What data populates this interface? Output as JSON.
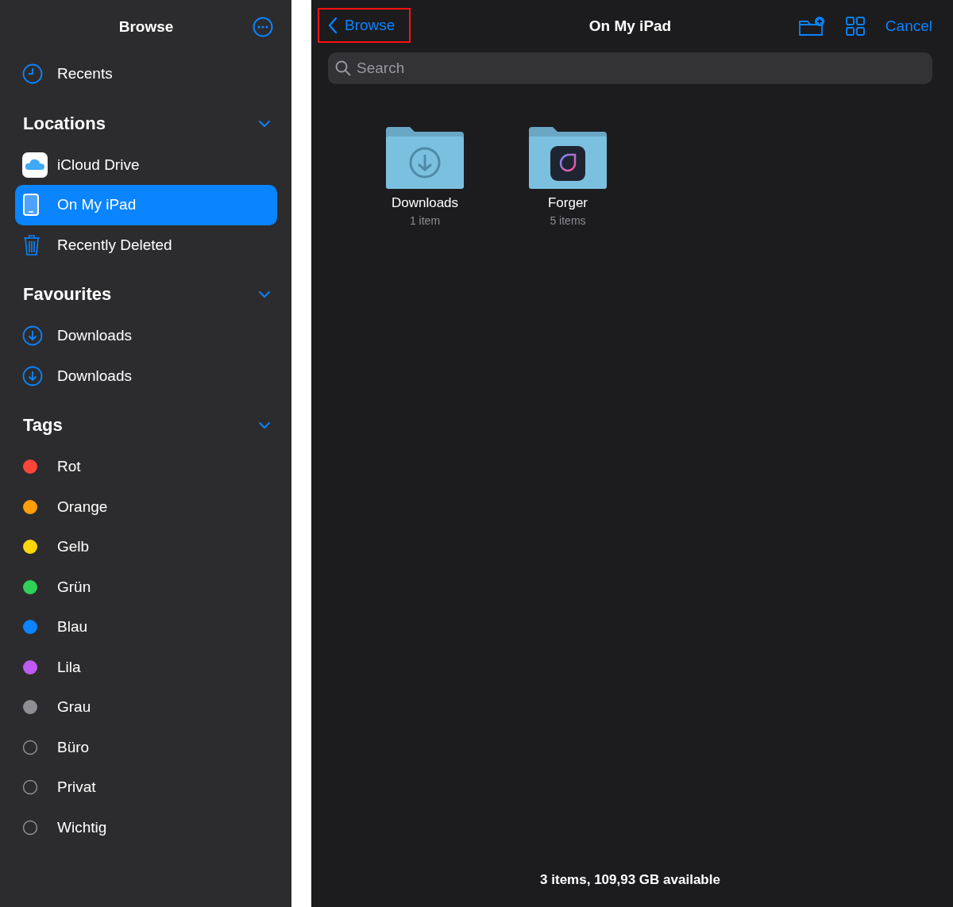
{
  "sidebar": {
    "title": "Browse",
    "recents": {
      "label": "Recents"
    },
    "sections": [
      {
        "title": "Locations",
        "expanded": true,
        "items": [
          {
            "label": "iCloud Drive",
            "kind": "cloud",
            "selected": false
          },
          {
            "label": "On My iPad",
            "kind": "tablet",
            "selected": true
          },
          {
            "label": "Recently Deleted",
            "kind": "trash",
            "selected": false
          }
        ]
      },
      {
        "title": "Favourites",
        "expanded": true,
        "items": [
          {
            "label": "Downloads",
            "kind": "download",
            "selected": false
          },
          {
            "label": "Downloads",
            "kind": "download",
            "selected": false
          }
        ]
      },
      {
        "title": "Tags",
        "expanded": true,
        "items": [
          {
            "label": "Rot",
            "kind": "tag",
            "color": "#ff453a",
            "selected": false
          },
          {
            "label": "Orange",
            "kind": "tag",
            "color": "#ff9f0a",
            "selected": false
          },
          {
            "label": "Gelb",
            "kind": "tag",
            "color": "#ffd60a",
            "selected": false
          },
          {
            "label": "Grün",
            "kind": "tag",
            "color": "#30d158",
            "selected": false
          },
          {
            "label": "Blau",
            "kind": "tag",
            "color": "#0a84ff",
            "selected": false
          },
          {
            "label": "Lila",
            "kind": "tag",
            "color": "#bf5af2",
            "selected": false
          },
          {
            "label": "Grau",
            "kind": "tag",
            "color": "#8e8e93",
            "selected": false
          },
          {
            "label": "Büro",
            "kind": "tag",
            "selected": false
          },
          {
            "label": "Privat",
            "kind": "tag",
            "selected": false
          },
          {
            "label": "Wichtig",
            "kind": "tag",
            "selected": false
          }
        ]
      }
    ]
  },
  "main": {
    "back": {
      "label": "Browse",
      "highlighted": true
    },
    "title": "On My iPad",
    "cancel": "Cancel",
    "search": {
      "placeholder": "Search"
    },
    "folders": [
      {
        "name": "Downloads",
        "count": "1 item",
        "kind": "download"
      },
      {
        "name": "Forger",
        "count": "5 items",
        "kind": "app"
      }
    ],
    "status": "3 items, 109,93 GB available"
  }
}
